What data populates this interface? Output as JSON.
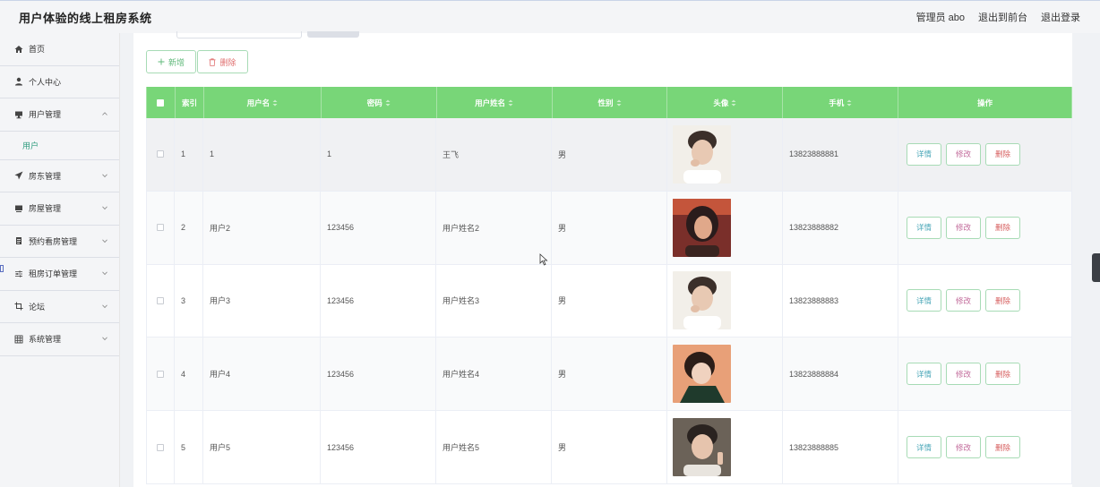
{
  "app": {
    "title": "用户体验的线上租房系统"
  },
  "header": {
    "admin_label": "管理员 abo",
    "front_link": "退出到前台",
    "logout_link": "退出登录"
  },
  "sidebar": {
    "items": [
      {
        "label": "首页",
        "icon": "home-icon"
      },
      {
        "label": "个人中心",
        "icon": "user-icon"
      },
      {
        "label": "用户管理",
        "icon": "monitor-icon",
        "expanded": true
      },
      {
        "label": "房东管理",
        "icon": "send-icon"
      },
      {
        "label": "房屋管理",
        "icon": "monitor-icon"
      },
      {
        "label": "预约看房管理",
        "icon": "document-icon"
      },
      {
        "label": "租房订单管理",
        "icon": "sliders-icon"
      },
      {
        "label": "论坛",
        "icon": "crop-icon"
      },
      {
        "label": "系统管理",
        "icon": "grid-icon"
      }
    ],
    "sub_item": "用户"
  },
  "toolbar": {
    "add_label": "新增",
    "delete_label": "删除"
  },
  "table": {
    "headers": [
      "索引",
      "用户名",
      "密码",
      "用户姓名",
      "性别",
      "头像",
      "手机",
      "操作"
    ],
    "action_labels": {
      "detail": "详情",
      "edit": "修改",
      "delete": "删除"
    },
    "rows": [
      {
        "index": "1",
        "username": "1",
        "password": "1",
        "name": "王飞",
        "gender": "男",
        "phone": "13823888881",
        "avatar_colors": [
          "#f2efe9",
          "#3b2f2a",
          "#e8c9b3"
        ]
      },
      {
        "index": "2",
        "username": "用户2",
        "password": "123456",
        "name": "用户姓名2",
        "gender": "男",
        "phone": "13823888882",
        "avatar_colors": [
          "#7a2f2a",
          "#2a1c1c",
          "#e0a88a"
        ]
      },
      {
        "index": "3",
        "username": "用户3",
        "password": "123456",
        "name": "用户姓名3",
        "gender": "男",
        "phone": "13823888883",
        "avatar_colors": [
          "#f2efe9",
          "#3b2f2a",
          "#e8c9b3"
        ]
      },
      {
        "index": "4",
        "username": "用户4",
        "password": "123456",
        "name": "用户姓名4",
        "gender": "男",
        "phone": "13823888884",
        "avatar_colors": [
          "#e8a078",
          "#1f3a2c",
          "#f0d2bf"
        ]
      },
      {
        "index": "5",
        "username": "用户5",
        "password": "123456",
        "name": "用户姓名5",
        "gender": "男",
        "phone": "13823888885",
        "avatar_colors": [
          "#6b6258",
          "#2a2320",
          "#e6c4ad"
        ]
      }
    ]
  },
  "colors": {
    "accent": "#78d678",
    "link_teal": "#2e9c7e"
  }
}
